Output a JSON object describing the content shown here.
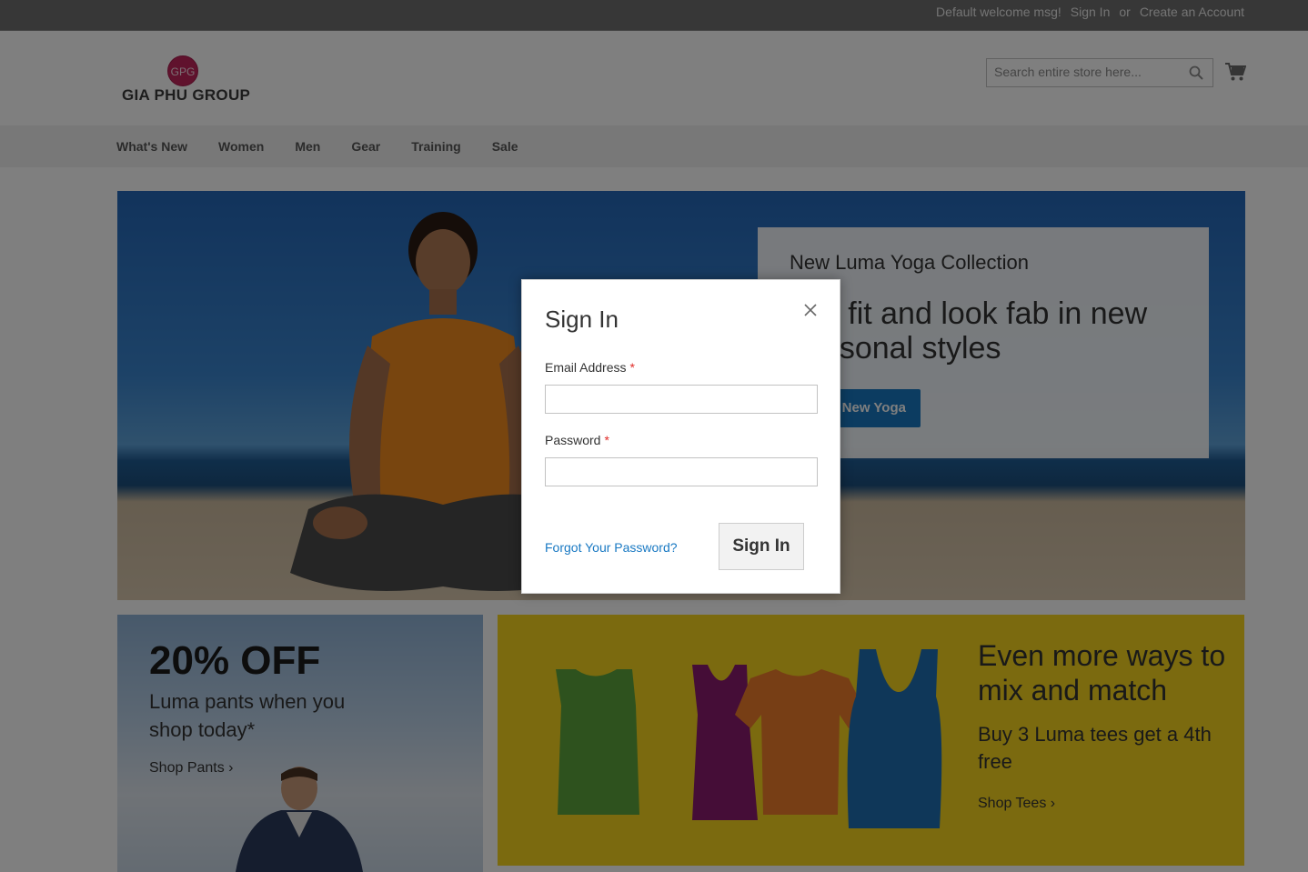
{
  "top_bar": {
    "welcome": "Default welcome msg!",
    "sign_in": "Sign In",
    "or": "or",
    "create_account": "Create an Account"
  },
  "logo": {
    "badge": "GPG",
    "name": "GIA PHU GROUP"
  },
  "search": {
    "placeholder": "Search entire store here...",
    "icon": "search-icon"
  },
  "cart": {
    "icon": "shopping-cart-icon"
  },
  "nav": {
    "items": [
      "What's New",
      "Women",
      "Men",
      "Gear",
      "Training",
      "Sale"
    ]
  },
  "hero": {
    "eyebrow": "New Luma Yoga Collection",
    "headline": "Get fit and look fab in new seasonal styles",
    "cta": "Shop New Yoga"
  },
  "promo_left": {
    "title": "20% OFF",
    "subtitle": "Luma pants when you shop today*",
    "link": "Shop Pants ›"
  },
  "promo_right": {
    "title": "Even more ways to mix and match",
    "subtitle": "Buy 3 Luma tees get a 4th free",
    "link": "Shop Tees ›"
  },
  "modal": {
    "title": "Sign In",
    "email_label": "Email Address",
    "password_label": "Password",
    "required_mark": "*",
    "forgot": "Forgot Your Password?",
    "submit": "Sign In",
    "close_icon": "close-icon"
  },
  "colors": {
    "accent": "#1979c3",
    "required": "#e02b27",
    "promo_yellow": "#f6d51e",
    "logo_badge": "#c0245b"
  }
}
